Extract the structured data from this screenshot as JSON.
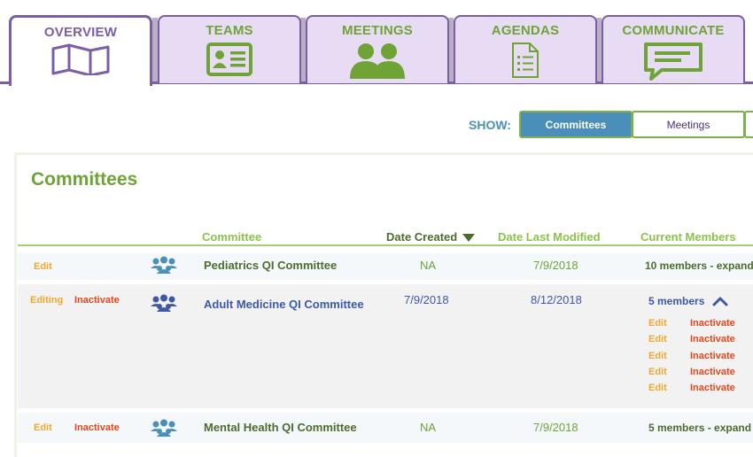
{
  "tabs": [
    {
      "label": "OVERVIEW",
      "icon": "map-icon",
      "active": true
    },
    {
      "label": "TEAMS",
      "icon": "id-card-icon",
      "active": false
    },
    {
      "label": "MEETINGS",
      "icon": "people-icon",
      "active": false
    },
    {
      "label": "AGENDAS",
      "icon": "checklist-document-icon",
      "active": false
    },
    {
      "label": "COMMUNICATE",
      "icon": "chat-bubble-icon",
      "active": false
    }
  ],
  "show": {
    "label": "SHOW:",
    "options": [
      "Committees",
      "Meetings"
    ],
    "selected": "Committees"
  },
  "panel": {
    "title": "Committees"
  },
  "table": {
    "columns": [
      "Committee",
      "Date Created",
      "Date Last Modified",
      "Current Members"
    ],
    "sorted_column": "Date Created",
    "rows": [
      {
        "edit_label": "Edit",
        "inactivate_label": "",
        "name": "Pediatrics QI Committee",
        "date_created": "NA",
        "date_modified": "7/9/2018",
        "members": "10 members - expand"
      },
      {
        "edit_label": "Editing",
        "inactivate_label": "Inactivate",
        "name": "Adult Medicine QI Committee",
        "date_created": "7/9/2018",
        "date_modified": "8/12/2018",
        "members": "5 members",
        "member_actions": [
          {
            "edit": "Edit",
            "inactivate": "Inactivate"
          },
          {
            "edit": "Edit",
            "inactivate": "Inactivate"
          },
          {
            "edit": "Edit",
            "inactivate": "Inactivate"
          },
          {
            "edit": "Edit",
            "inactivate": "Inactivate"
          },
          {
            "edit": "Edit",
            "inactivate": "Inactivate"
          }
        ]
      },
      {
        "edit_label": "Edit",
        "inactivate_label": "Inactivate",
        "name": "Mental Health QI Committee",
        "date_created": "NA",
        "date_modified": "7/9/2018",
        "members": "5 members - expand"
      }
    ]
  },
  "colors": {
    "purple": "#7b5ea7",
    "green": "#6fa336",
    "light_green": "#8bc34a",
    "blue": "#4a8fb9",
    "link_blue": "#3d58a8",
    "orange": "#f0a830",
    "red_orange": "#e8461a"
  }
}
